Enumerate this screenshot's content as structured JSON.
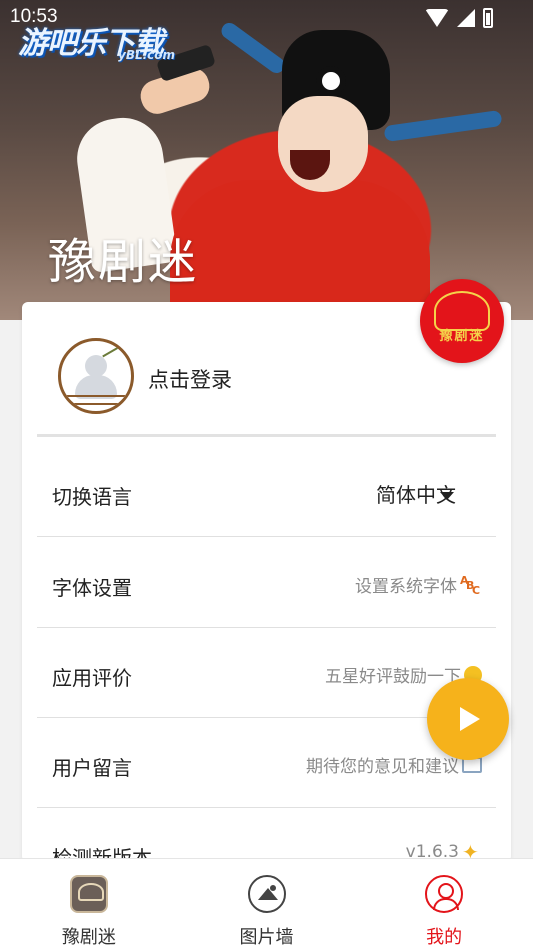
{
  "status_bar": {
    "time": "10:53"
  },
  "watermark": {
    "main": "游吧乐下载",
    "sub": "yBL.com"
  },
  "header": {
    "title": "豫剧迷"
  },
  "badge": {
    "text": "豫剧迷"
  },
  "profile": {
    "login_label": "点击登录"
  },
  "settings": [
    {
      "label": "切换语言",
      "value": "简体中文",
      "icon": "caret-down-icon"
    },
    {
      "label": "字体设置",
      "value": "设置系统字体",
      "icon": "abc-icon"
    },
    {
      "label": "应用评价",
      "value": "五星好评鼓励一下",
      "icon": "smiley-icon"
    },
    {
      "label": "用户留言",
      "value": "期待您的意见和建议",
      "icon": "computer-icon"
    },
    {
      "label": "检测新版本",
      "value": "v1.6.3",
      "icon": "sparkle-icon"
    }
  ],
  "bottom_nav": [
    {
      "label": "豫剧迷",
      "icon": "opera-icon",
      "active": false
    },
    {
      "label": "图片墙",
      "icon": "gallery-icon",
      "active": false
    },
    {
      "label": "我的",
      "icon": "profile-icon",
      "active": true
    }
  ],
  "colors": {
    "accent_red": "#e3141a",
    "fab_orange": "#f6b21b",
    "badge_gold": "#f5d34a"
  }
}
